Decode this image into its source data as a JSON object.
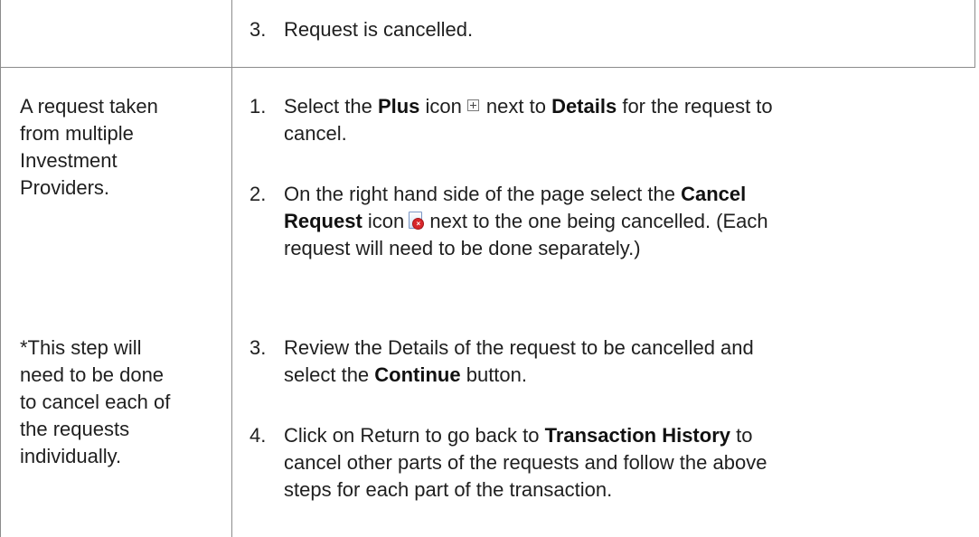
{
  "rows": [
    {
      "left": "",
      "steps": [
        {
          "num": "3.",
          "text": "Request is cancelled."
        }
      ]
    },
    {
      "left_lines": [
        "A request taken",
        "from multiple",
        "Investment",
        "Providers."
      ],
      "note_lines": [
        "*This step will",
        "need to be done",
        "to cancel each of",
        "the requests",
        "individually."
      ],
      "steps": [
        {
          "num": "1.",
          "parts": {
            "a": "Select the ",
            "b": "Plus",
            "c": " icon",
            "d": "next to ",
            "e": "Details",
            "f": " for the request to",
            "g": "cancel."
          }
        },
        {
          "num": "2.",
          "parts": {
            "a": "On the right hand side of the page select the ",
            "b": "Cancel",
            "c": "Request",
            "d": " icon",
            "e": " next to the one being cancelled. (Each",
            "f": "request will need to be done separately.)"
          }
        },
        {
          "num": "3.",
          "parts": {
            "a": "Review the Details of the request to be cancelled and",
            "b": "select the ",
            "c": "Continue",
            "d": " button."
          }
        },
        {
          "num": "4.",
          "parts": {
            "a": "Click on Return to go back to ",
            "b": "Transaction History",
            "c": " to",
            "d": "cancel other parts of the requests and follow the above",
            "e": "steps for each part of the transaction."
          }
        }
      ]
    }
  ],
  "icons": {
    "plus": "plus-box-icon",
    "cancel_request": "cancel-request-icon"
  }
}
